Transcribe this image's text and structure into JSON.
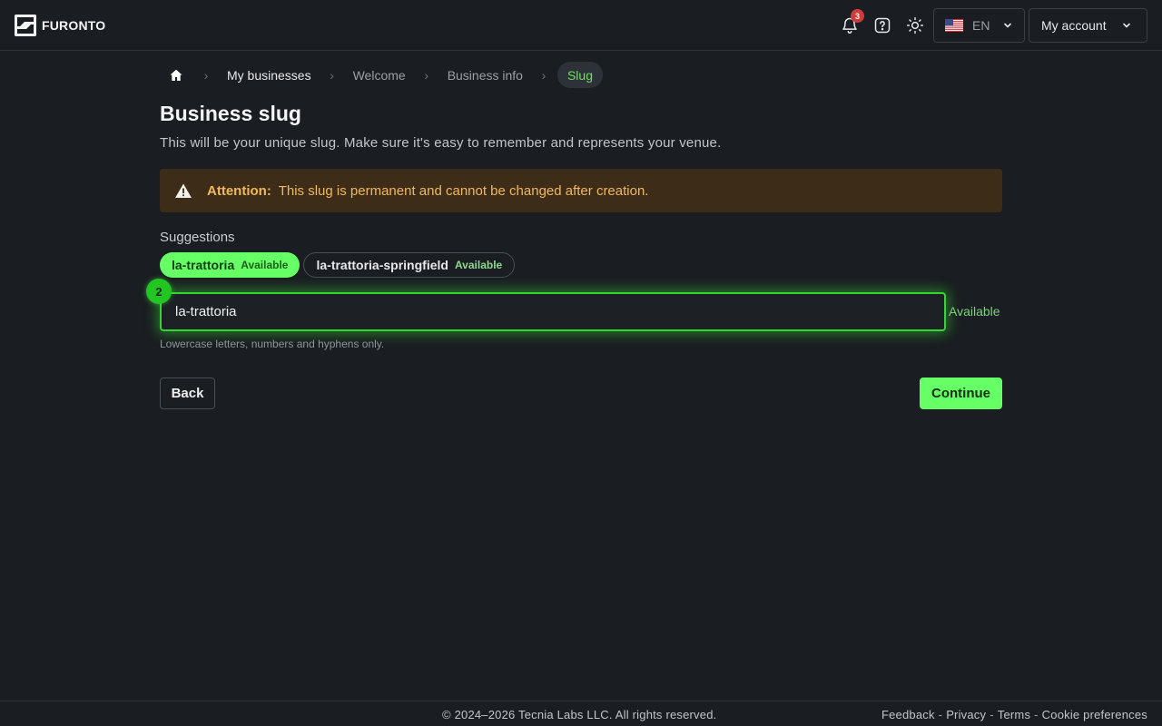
{
  "header": {
    "brand": "FURONTO",
    "notifications_count": "3",
    "language": "EN",
    "account_label": "My account"
  },
  "breadcrumb": {
    "items": [
      "My businesses",
      "Welcome",
      "Business info",
      "Slug"
    ]
  },
  "page": {
    "title": "Business slug",
    "subtitle": "This will be your unique slug. Make sure it's easy to remember and represents your venue."
  },
  "alert": {
    "label": "Attention:",
    "message": "This slug is permanent and cannot be changed after creation."
  },
  "suggestions": {
    "label": "Suggestions",
    "items": [
      {
        "slug": "la-trattoria",
        "status": "Available",
        "selected": true
      },
      {
        "slug": "la-trattoria-springfield",
        "status": "Available",
        "selected": false
      }
    ]
  },
  "slug_field": {
    "value": "la-trattoria",
    "status": "Available",
    "hint": "Lowercase letters, numbers and hyphens only.",
    "step": "2"
  },
  "actions": {
    "back_label": "Back",
    "continue_label": "Continue"
  },
  "footer": {
    "copyright": "© 2024–2026 Tecnia Labs LLC. All rights reserved.",
    "links": [
      "Feedback",
      "Privacy",
      "Terms",
      "Cookie preferences"
    ]
  },
  "colors": {
    "accent": "#66ff66",
    "background": "#1a1d21",
    "warning_bg": "#3d2c18",
    "warning_text": "#f0b95c"
  },
  "icons": {
    "brand": "furonto-logo-icon",
    "notifications": "bell-icon",
    "help": "question-icon",
    "theme": "sun-icon",
    "language": "us-flag-icon",
    "home": "home-icon",
    "warning": "warning-triangle-icon"
  }
}
